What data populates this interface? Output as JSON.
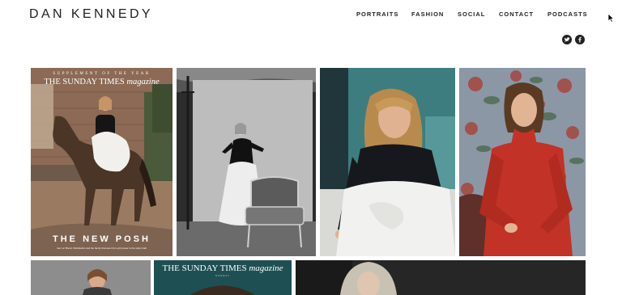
{
  "site": {
    "logo": "DAN KENNEDY"
  },
  "nav": {
    "items": [
      "PORTRAITS",
      "FASHION",
      "SOCIAL",
      "CONTACT",
      "PODCASTS"
    ]
  },
  "social": {
    "icons": [
      "twitter-icon",
      "facebook-icon"
    ]
  },
  "gallery": {
    "cover": {
      "supplement": "SUPPLEMENT OF THE YEAR",
      "masthead_a": "THE SUNDAY TIMES ",
      "masthead_b": "magazine",
      "headline": "THE NEW POSH",
      "small_print": "Geri on Brexit, Wimbledon and the family that went from girl power to the Holy Grail"
    },
    "magazine": {
      "masthead_a": "THE SUNDAY TIMES ",
      "masthead_b": "magazine",
      "issue": "SUNDAY"
    }
  },
  "colors": {
    "text": "#1f1f1f",
    "icon_bg": "#222222",
    "red_dress": "#c23226",
    "teal_wall": "#3d7d80",
    "tapestry": "#8b97a5"
  }
}
